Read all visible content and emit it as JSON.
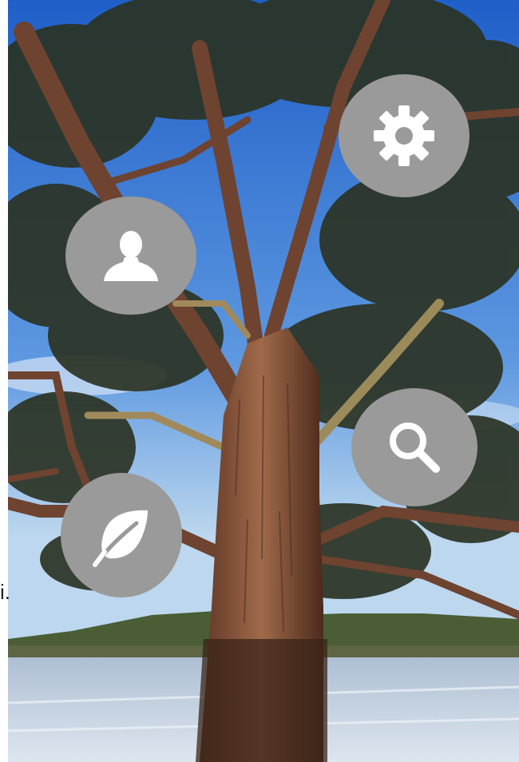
{
  "colors": {
    "fab_background": "#9a9a9a",
    "fab_icon": "#ffffff",
    "sky_top": "#2e6fd0",
    "sky_bottom": "#bcd7ee",
    "trunk": "#8b5a3c",
    "water": "#c9d6e3"
  },
  "fab_buttons": [
    {
      "name": "settings-button",
      "icon": "gear-icon"
    },
    {
      "name": "profile-button",
      "icon": "user-icon"
    },
    {
      "name": "search-button",
      "icon": "search-icon"
    },
    {
      "name": "eco-button",
      "icon": "leaf-icon"
    }
  ],
  "edge_text": "i."
}
